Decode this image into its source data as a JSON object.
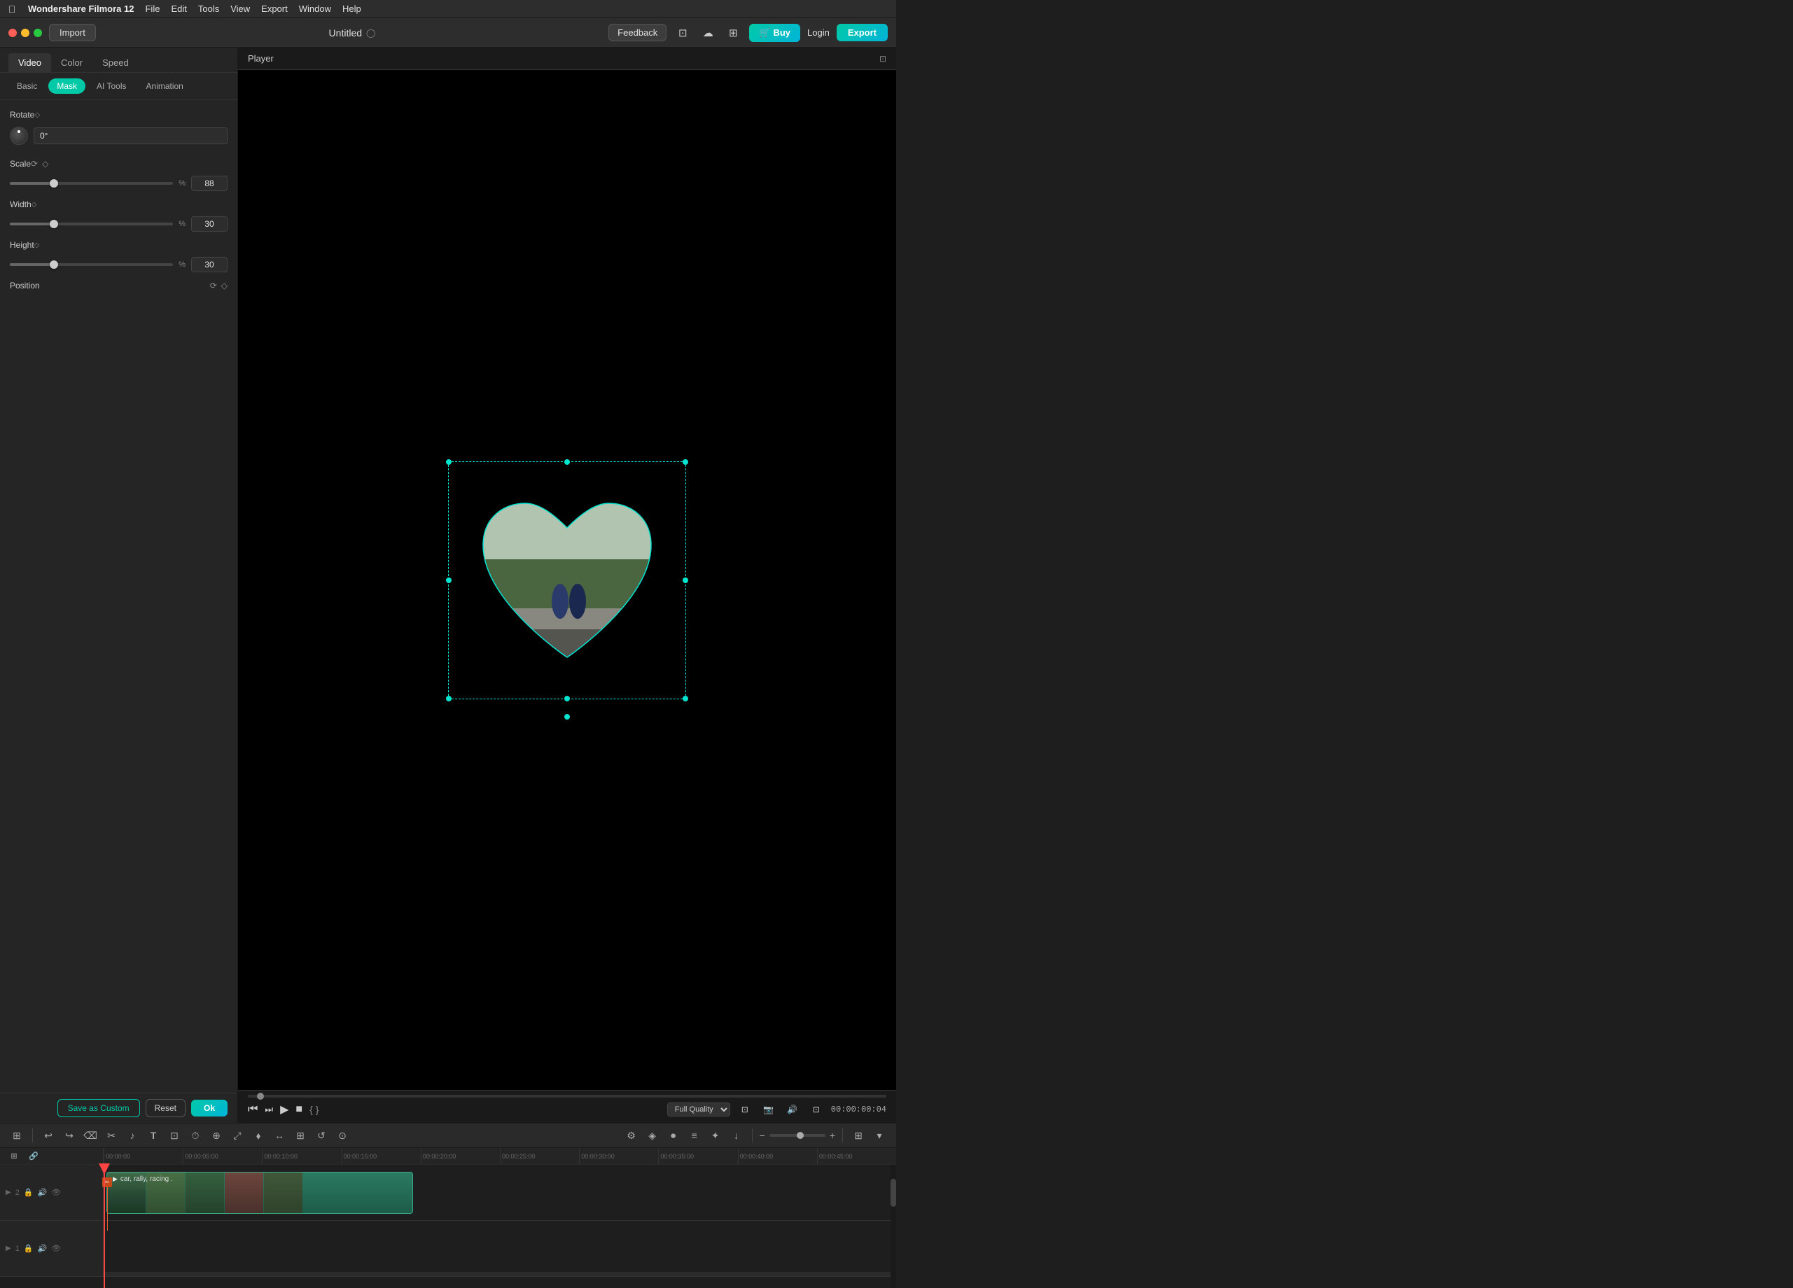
{
  "app": {
    "name": "Wondershare Filmora 12",
    "title": "Untitled",
    "menu": [
      "File",
      "Edit",
      "Tools",
      "View",
      "Export",
      "Window",
      "Help"
    ]
  },
  "titlebar": {
    "import_label": "Import",
    "feedback_label": "Feedback",
    "buy_label": "Buy",
    "login_label": "Login",
    "export_label": "Export"
  },
  "tabs": {
    "main": [
      "Video",
      "Color",
      "Speed"
    ],
    "active_main": "Video",
    "sub": [
      "Basic",
      "Mask",
      "AI Tools",
      "Animation"
    ],
    "active_sub": "Mask"
  },
  "properties": {
    "rotate": {
      "label": "Rotate",
      "value": "0°"
    },
    "scale": {
      "label": "Scale",
      "unit": "%",
      "value": "88",
      "thumb_pct": 27
    },
    "width": {
      "label": "Width",
      "unit": "%",
      "value": "30",
      "thumb_pct": 27
    },
    "height": {
      "label": "Height",
      "unit": "%",
      "value": "30",
      "thumb_pct": 27
    },
    "position": {
      "label": "Position"
    }
  },
  "panel_footer": {
    "save_custom": "Save as Custom",
    "reset": "Reset",
    "ok": "Ok"
  },
  "player": {
    "title": "Player",
    "quality": "Full Quality",
    "timecode": "00:00:00:04"
  },
  "timeline": {
    "tracks": [
      {
        "num": "2",
        "clip": {
          "label": "car, rally, racing .",
          "left_pct": 1,
          "width_pct": 39
        }
      },
      {
        "num": "1"
      }
    ],
    "ruler_marks": [
      "00:00:00",
      "00:00:05:00",
      "00:00:10:00",
      "00:00:15:00",
      "00:00:20:00",
      "00:00:25:00",
      "00:00:30:00",
      "00:00:35:00",
      "00:00:40:00",
      "00:00:45:00"
    ]
  },
  "icons": {
    "apple": "",
    "close": "✕",
    "sync": "⟳",
    "diamond": "◇",
    "undo": "↩",
    "redo": "↪",
    "delete": "⌫",
    "scissors": "✂",
    "music": "♪",
    "text": "T",
    "crop": "⊡",
    "speed": "⏱",
    "magnet": "⊕",
    "resize": "⤢",
    "diamond2": "⬧",
    "layers": "⊞",
    "gear": "⚙",
    "shield": "⛉",
    "mic": "⏺",
    "grid": "⊞",
    "minus": "−",
    "plus": "+",
    "play": "▶",
    "rewind": "⏮",
    "step_back": "⏭",
    "fast_fwd": "⏩",
    "stop": "■",
    "camera": "📷",
    "speaker": "🔊",
    "eye": "👁",
    "lock": "🔒",
    "link": "🔗",
    "cart": "🛒"
  }
}
